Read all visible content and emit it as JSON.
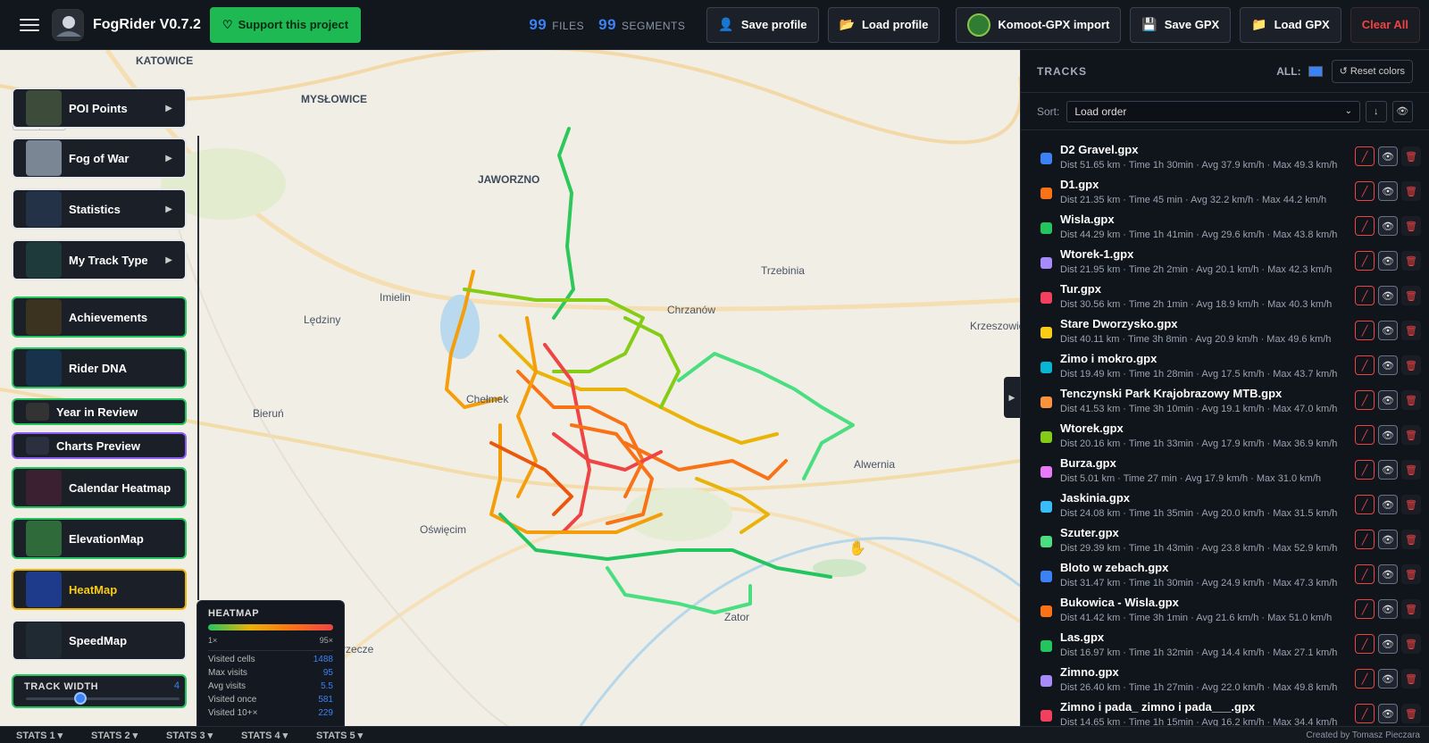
{
  "app": {
    "title": "FogRider V0.7.2",
    "support_label": "Support this project"
  },
  "counts": {
    "files": "99",
    "files_label": "FILES",
    "segments": "99",
    "segments_label": "SEGMENTS"
  },
  "toolbar": {
    "save_profile": "Save profile",
    "load_profile": "Load profile",
    "komoot": "Komoot-GPX import",
    "save_gpx": "Save GPX",
    "load_gpx": "Load GPX",
    "clear_all": "Clear All"
  },
  "map": {
    "zoom_in": "+",
    "zoom_out": "−",
    "labels": [
      "KATOWICE",
      "MYSŁOWICE",
      "JAWORZNO",
      "Trzebinia",
      "Imielin",
      "Chrzanów",
      "Lędziny",
      "Krzeszowice",
      "Chełmek",
      "Bieruń",
      "Alwernia",
      "Oświęcim",
      "Zator",
      "Przecze"
    ]
  },
  "menu": [
    {
      "label": "POI Points",
      "arrow": "▶"
    },
    {
      "label": "Fog of War",
      "arrow": "▶"
    },
    {
      "label": "Statistics",
      "arrow": "▶"
    },
    {
      "label": "My Track Type",
      "arrow": "▶"
    },
    {
      "label": "Achievements"
    },
    {
      "label": "Rider DNA"
    },
    {
      "label": "Year in Review"
    },
    {
      "label": "Charts Preview"
    },
    {
      "label": "Calendar Heatmap"
    },
    {
      "label": "ElevationMap"
    },
    {
      "label": "HeatMap"
    },
    {
      "label": "SpeedMap"
    }
  ],
  "track_width": {
    "label": "TRACK WIDTH",
    "value": "4"
  },
  "heatmap": {
    "title": "HEATMAP",
    "min": "1×",
    "max": "95×",
    "rows": [
      {
        "k": "Visited cells",
        "v": "1488"
      },
      {
        "k": "Max visits",
        "v": "95"
      },
      {
        "k": "Avg visits",
        "v": "5.5"
      },
      {
        "k": "Visited once",
        "v": "581"
      },
      {
        "k": "Visited 10+×",
        "v": "229"
      }
    ]
  },
  "stats_tabs": [
    "STATS 1 ▾",
    "STATS 2 ▾",
    "STATS 3 ▾",
    "STATS 4 ▾",
    "STATS 5 ▾"
  ],
  "credit": "Created by Tomasz Pieczara",
  "panel": {
    "title": "TRACKS",
    "all_label": "ALL:",
    "reset": "↺ Reset colors",
    "sort_label": "Sort:",
    "sort_value": "Load order",
    "sort_dir": "↓",
    "eye": "👁"
  },
  "tracks": [
    {
      "name": "D2 Gravel.gpx",
      "details": "Dist 51.65 km · Time 1h 30min · Avg 37.9 km/h · Max 49.3 km/h",
      "color": "#3b82f6"
    },
    {
      "name": "D1.gpx",
      "details": "Dist 21.35 km · Time 45 min · Avg 32.2 km/h · Max 44.2 km/h",
      "color": "#f97316"
    },
    {
      "name": "Wisla.gpx",
      "details": "Dist 44.29 km · Time 1h 41min · Avg 29.6 km/h · Max 43.8 km/h",
      "color": "#22c55e"
    },
    {
      "name": "Wtorek-1.gpx",
      "details": "Dist 21.95 km · Time 2h 2min · Avg 20.1 km/h · Max 42.3 km/h",
      "color": "#a78bfa"
    },
    {
      "name": "Tur.gpx",
      "details": "Dist 30.56 km · Time 2h 1min · Avg 18.9 km/h · Max 40.3 km/h",
      "color": "#f43f5e"
    },
    {
      "name": "Stare Dworzysko.gpx",
      "details": "Dist 40.11 km · Time 3h 8min · Avg 20.9 km/h · Max 49.6 km/h",
      "color": "#facc15"
    },
    {
      "name": "Zimo i mokro.gpx",
      "details": "Dist 19.49 km · Time 1h 28min · Avg 17.5 km/h · Max 43.7 km/h",
      "color": "#06b6d4"
    },
    {
      "name": "Tenczynski Park Krajobrazowy MTB.gpx",
      "details": "Dist 41.53 km · Time 3h 10min · Avg 19.1 km/h · Max 47.0 km/h",
      "color": "#fb923c"
    },
    {
      "name": "Wtorek.gpx",
      "details": "Dist 20.16 km · Time 1h 33min · Avg 17.9 km/h · Max 36.9 km/h",
      "color": "#84cc16"
    },
    {
      "name": "Burza.gpx",
      "details": "Dist 5.01 km · Time 27 min · Avg 17.9 km/h · Max 31.0 km/h",
      "color": "#e879f9"
    },
    {
      "name": "Jaskinia.gpx",
      "details": "Dist 24.08 km · Time 1h 35min · Avg 20.0 km/h · Max 31.5 km/h",
      "color": "#38bdf8"
    },
    {
      "name": "Szuter.gpx",
      "details": "Dist 29.39 km · Time 1h 43min · Avg 23.8 km/h · Max 52.9 km/h",
      "color": "#4ade80"
    },
    {
      "name": "Bloto w zebach.gpx",
      "details": "Dist 31.47 km · Time 1h 30min · Avg 24.9 km/h · Max 47.3 km/h",
      "color": "#3b82f6"
    },
    {
      "name": "Bukowica - Wisla.gpx",
      "details": "Dist 41.42 km · Time 3h 1min · Avg 21.6 km/h · Max 51.0 km/h",
      "color": "#f97316"
    },
    {
      "name": "Las.gpx",
      "details": "Dist 16.97 km · Time 1h 32min · Avg 14.4 km/h · Max 27.1 km/h",
      "color": "#22c55e"
    },
    {
      "name": "Zimno.gpx",
      "details": "Dist 26.40 km · Time 1h 27min · Avg 22.0 km/h · Max 49.8 km/h",
      "color": "#a78bfa"
    },
    {
      "name": "Zimno i pada_ zimno i pada___.gpx",
      "details": "Dist 14.65 km · Time 1h 15min · Avg 16.2 km/h · Max 34.4 km/h",
      "color": "#f43f5e"
    }
  ],
  "track_buttons": {
    "edit": "╱",
    "view": "👁",
    "delete": "🗑"
  }
}
